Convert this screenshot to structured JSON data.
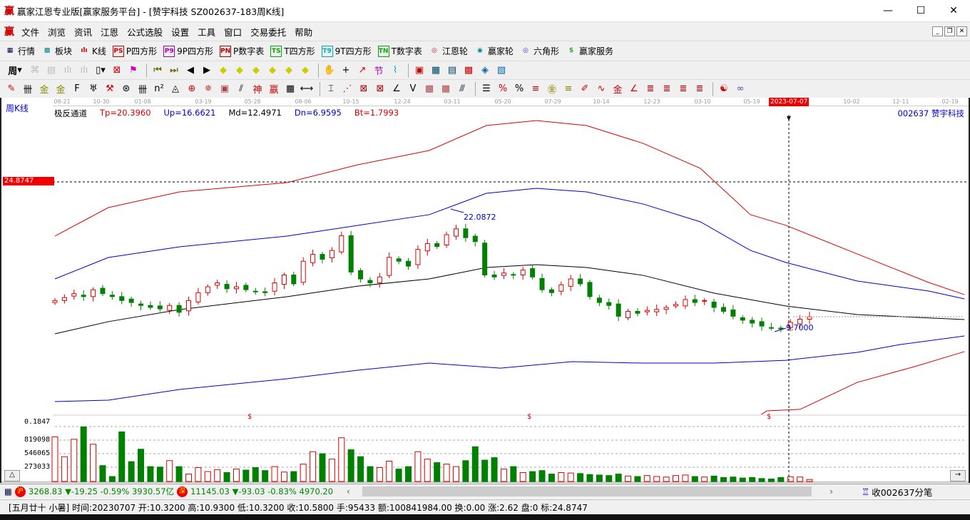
{
  "window": {
    "title": "赢家江恩专业版[赢家服务平台] - [赞宇科技  SZ002637-183周K线]",
    "logo": "赢",
    "minimize": "—",
    "maximize": "☐",
    "close": "✕"
  },
  "menu": {
    "logo": "赢",
    "items": [
      "文件",
      "浏览",
      "资讯",
      "江恩",
      "公式选股",
      "设置",
      "工具",
      "窗口",
      "交易委托",
      "帮助"
    ]
  },
  "toolbar1": [
    {
      "icon": "quote-table-icon",
      "glyph": "▦",
      "color": "#004",
      "label": "行情"
    },
    {
      "icon": "sector-icon",
      "glyph": "▩",
      "color": "#088",
      "label": "板块"
    },
    {
      "icon": "kline-icon",
      "glyph": "ılı",
      "color": "#c00",
      "label": "K线"
    },
    {
      "icon": "ps-icon",
      "glyph": "PS",
      "color": "#c00",
      "label": "P四方形"
    },
    {
      "icon": "p9-icon",
      "glyph": "P9",
      "color": "#a0a",
      "label": "9P四方形"
    },
    {
      "icon": "pn-icon",
      "glyph": "PN",
      "color": "#a00",
      "label": "P数字表"
    },
    {
      "icon": "ts-icon",
      "glyph": "TS",
      "color": "#0a0",
      "label": "T四方形"
    },
    {
      "icon": "t9-icon",
      "glyph": "T9",
      "color": "#0aa",
      "label": "9T四方形"
    },
    {
      "icon": "tn-icon",
      "glyph": "TN",
      "color": "#0a0",
      "label": "T数字表"
    },
    {
      "icon": "gann-wheel-icon",
      "glyph": "◎",
      "color": "#a22",
      "label": "江恩轮"
    },
    {
      "icon": "winner-wheel-icon",
      "glyph": "◉",
      "color": "#088",
      "label": "赢家轮"
    },
    {
      "icon": "hexagon-icon",
      "glyph": "◎",
      "color": "#33c",
      "label": "六角形"
    },
    {
      "icon": "dollar-icon",
      "glyph": "$",
      "color": "#3a3",
      "label": "赢家服务"
    }
  ],
  "toolbar2": {
    "period": "周"
  },
  "chart": {
    "period_label": "周K线",
    "indicator": "极反通道",
    "tp": "Tp=20.3960",
    "up": "Up=16.6621",
    "md": "Md=12.4971",
    "dn": "Dn=6.9595",
    "bt": "Bt=1.7993",
    "stock": "002637  赞宇科技",
    "cursor_price": "24.8747",
    "cursor_date": "2023-07-07",
    "high_label": "22.0872",
    "low_label": "9.7000",
    "dollar": "$",
    "dates": [
      "08-21",
      "10-30",
      "01-08",
      "03-19",
      "05-28",
      "08-06",
      "10-15",
      "12-24",
      "03-11",
      "05-20",
      "07-29",
      "10-14",
      "12-23",
      "03-10",
      "05-19",
      "10-02",
      "12-11",
      "02-19"
    ],
    "vol_labels": [
      "0.1847",
      "819098",
      "546065",
      "273033"
    ]
  },
  "chart_data": {
    "type": "candlestick",
    "title": "赞宇科技 SZ002637 周K线 极反通道",
    "price_ref": 24.8747,
    "closes": [
      12.8,
      13.1,
      13.5,
      13.2,
      13.9,
      13.5,
      13.2,
      12.8,
      12.6,
      12.3,
      12.1,
      11.95,
      12.3,
      11.6,
      12.8,
      13.6,
      14.2,
      14.6,
      14.0,
      14.2,
      13.9,
      13.7,
      13.6,
      14.6,
      15.4,
      14.5,
      16.8,
      17.5,
      17.0,
      17.9,
      19.4,
      15.7,
      15.0,
      14.6,
      15.2,
      17.2,
      16.8,
      16.3,
      18.0,
      18.6,
      18.3,
      19.5,
      20.1,
      19.2,
      18.8,
      15.4,
      15.2,
      15.6,
      15.4,
      15.9,
      15.2,
      13.9,
      13.6,
      14.4,
      15.0,
      14.5,
      13.2,
      12.6,
      12.3,
      11.2,
      11.7,
      11.5,
      11.8,
      11.9,
      12.1,
      12.4,
      12.9,
      12.6,
      12.8,
      12.1,
      11.7,
      11.2,
      10.8,
      10.5,
      10.2,
      10.0,
      9.9,
      10.58,
      10.9,
      11.15
    ],
    "volumes": [
      900000,
      500000,
      850000,
      1100000,
      750000,
      320000,
      100000,
      1000000,
      400000,
      650000,
      300000,
      290000,
      420000,
      300000,
      150000,
      280000,
      200000,
      240000,
      180000,
      250000,
      230000,
      280000,
      220000,
      300000,
      190000,
      200000,
      350000,
      600000,
      560000,
      450000,
      880000,
      640000,
      500000,
      300000,
      280000,
      410000,
      250000,
      300000,
      600000,
      450000,
      380000,
      350000,
      300000,
      420000,
      700000,
      430000,
      480000,
      250000,
      300000,
      180000,
      200000,
      220000,
      150000,
      180000,
      170000,
      160000,
      140000,
      130000,
      120000,
      150000,
      110000,
      100000,
      120000,
      100000,
      90000,
      120000,
      130000,
      100000,
      90000,
      110000,
      80000,
      90000,
      70000,
      80000,
      60000,
      50000,
      80000,
      95433,
      90000,
      40000
    ],
    "channels": [
      {
        "name": "upper_red",
        "color": "#e00000",
        "points": [
          [
            0,
            19.36
          ],
          [
            12.8,
            22.26
          ],
          [
            29.9,
            23.86
          ],
          [
            55.6,
            24.8
          ],
          [
            72.6,
            26.62
          ],
          [
            89.7,
            28.07
          ],
          [
            103.4,
            30.61
          ],
          [
            115.4,
            31.12
          ],
          [
            127.4,
            30.61
          ],
          [
            141,
            28.79
          ],
          [
            154.7,
            26.25
          ],
          [
            166.7,
            21.54
          ],
          [
            175.2,
            20.45
          ],
          [
            192.3,
            17.54
          ],
          [
            209.4,
            14.64
          ],
          [
            218,
            13.4
          ]
        ]
      },
      {
        "name": "upper_blue",
        "color": "#0000d0",
        "points": [
          [
            0,
            15.0
          ],
          [
            12.8,
            17.18
          ],
          [
            29.9,
            18.27
          ],
          [
            55.6,
            19.36
          ],
          [
            72.6,
            20.45
          ],
          [
            89.7,
            21.54
          ],
          [
            103.4,
            23.71
          ],
          [
            115.4,
            24.22
          ],
          [
            127.4,
            23.86
          ],
          [
            141,
            22.62
          ],
          [
            154.7,
            20.81
          ],
          [
            166.7,
            17.9
          ],
          [
            175.2,
            16.67
          ],
          [
            192.3,
            14.78
          ],
          [
            209.4,
            13.77
          ],
          [
            218,
            12.97
          ]
        ]
      },
      {
        "name": "middle",
        "color": "#000000",
        "points": [
          [
            0,
            9.41
          ],
          [
            12.8,
            10.65
          ],
          [
            29.9,
            11.88
          ],
          [
            55.6,
            13.19
          ],
          [
            72.6,
            14.27
          ],
          [
            89.7,
            15.0
          ],
          [
            103.4,
            16.16
          ],
          [
            115.4,
            16.45
          ],
          [
            127.4,
            16.16
          ],
          [
            141,
            15.36
          ],
          [
            158,
            13.55
          ],
          [
            175.2,
            12.24
          ],
          [
            192.3,
            11.37
          ],
          [
            218,
            10.86
          ]
        ]
      },
      {
        "name": "lower_blue",
        "color": "#0000d0",
        "points": [
          [
            0,
            2.51
          ],
          [
            12.8,
            2.66
          ],
          [
            29.9,
            3.75
          ],
          [
            55.6,
            4.84
          ],
          [
            72.6,
            5.71
          ],
          [
            89.7,
            6.43
          ],
          [
            106.8,
            5.92
          ],
          [
            123.9,
            6.58
          ],
          [
            141,
            6.43
          ],
          [
            158,
            6.43
          ],
          [
            175.2,
            6.72
          ],
          [
            192.3,
            7.52
          ],
          [
            202.6,
            8.32
          ],
          [
            218,
            9.19
          ]
        ]
      },
      {
        "name": "lower_red",
        "color": "#e00000",
        "points": [
          [
            161,
            -0.1
          ],
          [
            168,
            0.84
          ],
          [
            170.6,
            1.57
          ],
          [
            178.6,
            1.72
          ],
          [
            192.3,
            4.47
          ],
          [
            206,
            6.07
          ],
          [
            218,
            7.6
          ]
        ]
      }
    ],
    "weeks": 183,
    "xlabel": "",
    "ylabel": ""
  },
  "indexbar": {
    "sh_badge": "沪",
    "sh": "3268.83 ▼-19.25 -0.59% 3930.57亿",
    "sz_badge": "深",
    "sz": "11145.03 ▼-93.03 -0.83% 4970.20",
    "right": "收002637分笔"
  },
  "status": "[五月廿十 小暑] 时间:20230707 开:10.3200 高:10.9300 低:10.3200 收:10.5800 手:95433 额:100841984.00 换:0.00 涨:2.62 盘:0 标:24.8747"
}
